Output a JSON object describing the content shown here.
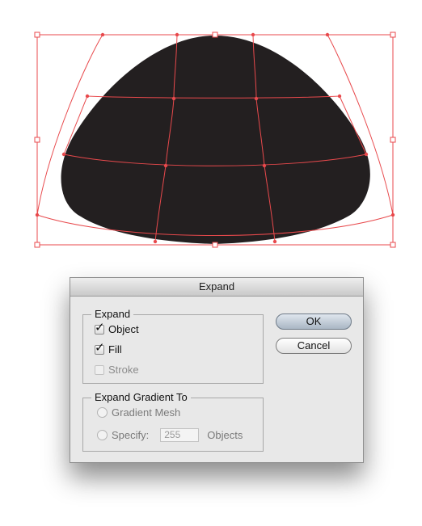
{
  "dialog": {
    "title": "Expand",
    "expand_group": {
      "title": "Expand",
      "options": [
        {
          "label": "Object",
          "checked": true,
          "enabled": true
        },
        {
          "label": "Fill",
          "checked": true,
          "enabled": true
        },
        {
          "label": "Stroke",
          "checked": false,
          "enabled": false
        }
      ]
    },
    "gradient_group": {
      "title": "Expand Gradient To",
      "gradient_mesh_label": "Gradient Mesh",
      "specify_label": "Specify:",
      "specify_value": "255",
      "objects_label": "Objects"
    },
    "ok_label": "OK",
    "cancel_label": "Cancel"
  },
  "colors": {
    "shape_fill": "#231f20",
    "envelope_stroke": "#e8494c",
    "default_button": "#a9b6c4"
  }
}
